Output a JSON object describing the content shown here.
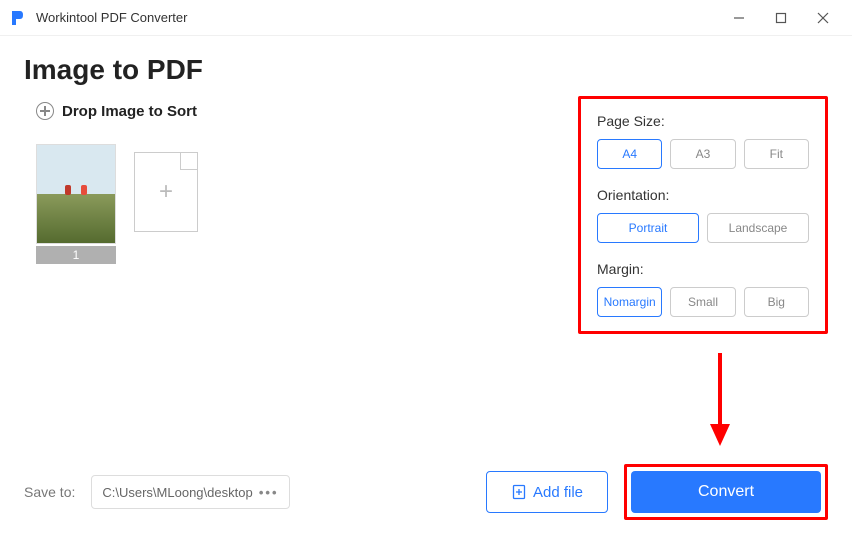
{
  "titlebar": {
    "app_name": "Workintool PDF Converter"
  },
  "page": {
    "title": "Image to PDF",
    "drop_label": "Drop Image to Sort"
  },
  "thumbnails": {
    "first_index": "1"
  },
  "settings": {
    "page_size": {
      "label": "Page Size:",
      "options": [
        "A4",
        "A3",
        "Fit"
      ],
      "selected": "A4"
    },
    "orientation": {
      "label": "Orientation:",
      "options": [
        "Portrait",
        "Landscape"
      ],
      "selected": "Portrait"
    },
    "margin": {
      "label": "Margin:",
      "options": [
        "Nomargin",
        "Small",
        "Big"
      ],
      "selected": "Nomargin"
    }
  },
  "footer": {
    "save_label": "Save to:",
    "save_path": "C:\\Users\\MLoong\\desktop",
    "add_file_label": "Add file",
    "convert_label": "Convert"
  }
}
